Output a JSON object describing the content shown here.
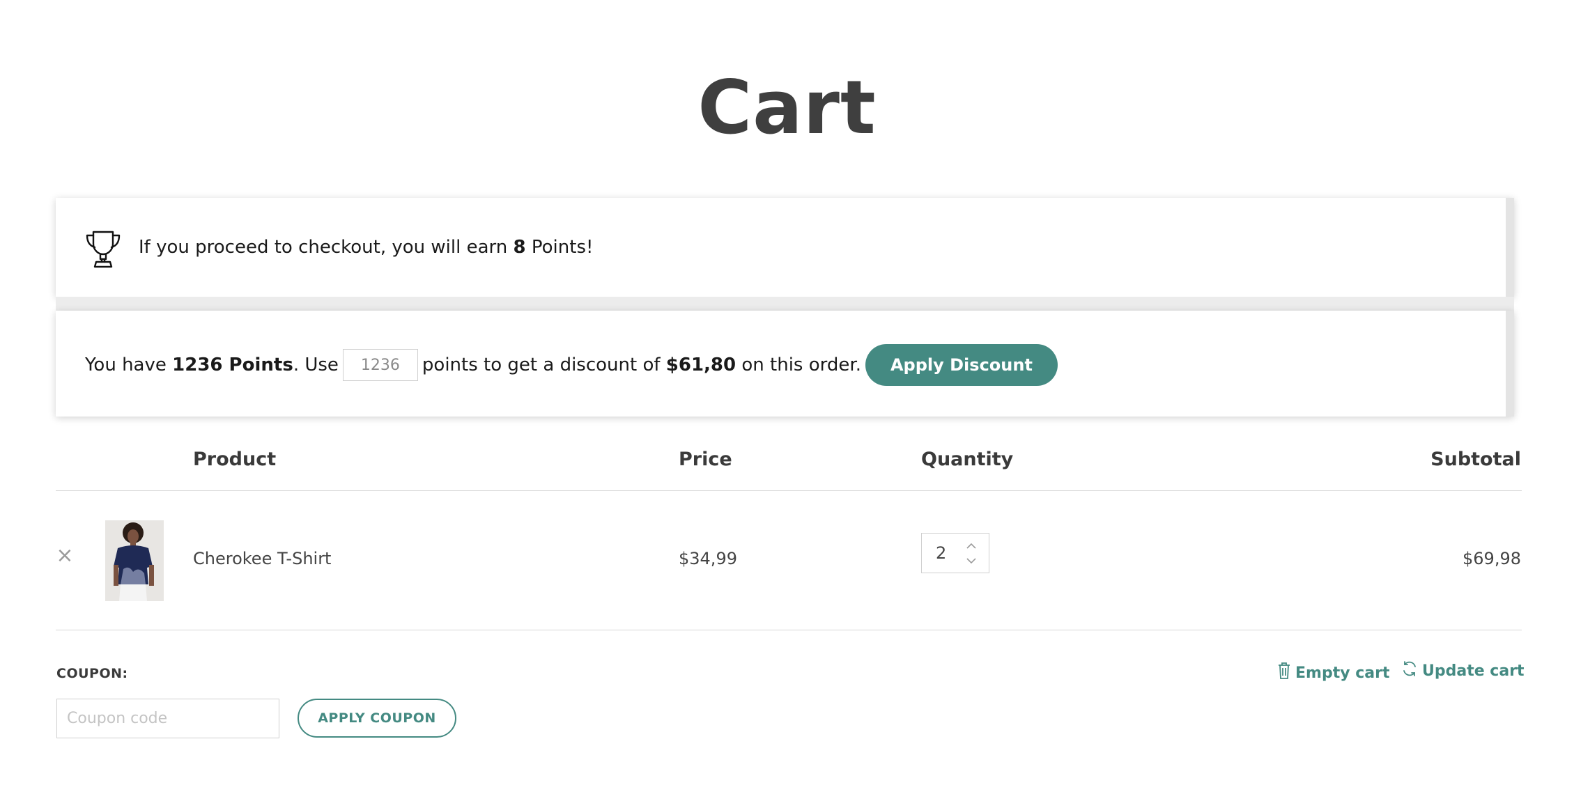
{
  "page": {
    "title": "Cart"
  },
  "points_earn": {
    "icon": "trophy-icon",
    "text_before": "If you proceed to checkout, you will earn ",
    "points": "8",
    "text_after": " Points!"
  },
  "points_redeem": {
    "text_prefix": "You have ",
    "points_balance": "1236 Points",
    "text_use": ". Use",
    "input_value": "1236",
    "text_middle": "points to get a discount of ",
    "discount_amount": "$61,80",
    "text_suffix": " on this order.",
    "button_label": "Apply Discount"
  },
  "table": {
    "headers": {
      "product": "Product",
      "price": "Price",
      "quantity": "Quantity",
      "subtotal": "Subtotal"
    },
    "rows": [
      {
        "remove_icon": "close-icon",
        "remove_glyph": "×",
        "thumbnail": "product-thumbnail",
        "name": "Cherokee T-Shirt",
        "price": "$34,99",
        "quantity": "2",
        "subtotal": "$69,98"
      }
    ]
  },
  "coupon": {
    "label": "COUPON:",
    "placeholder": "Coupon code",
    "button_label": "APPLY COUPON"
  },
  "cart_actions": {
    "empty_label": "Empty cart",
    "empty_icon": "trash-icon",
    "update_label": "Update cart",
    "update_icon": "refresh-icon"
  },
  "colors": {
    "accent": "#448a82",
    "title": "#3f3f3f",
    "text": "#1a1a1a"
  }
}
